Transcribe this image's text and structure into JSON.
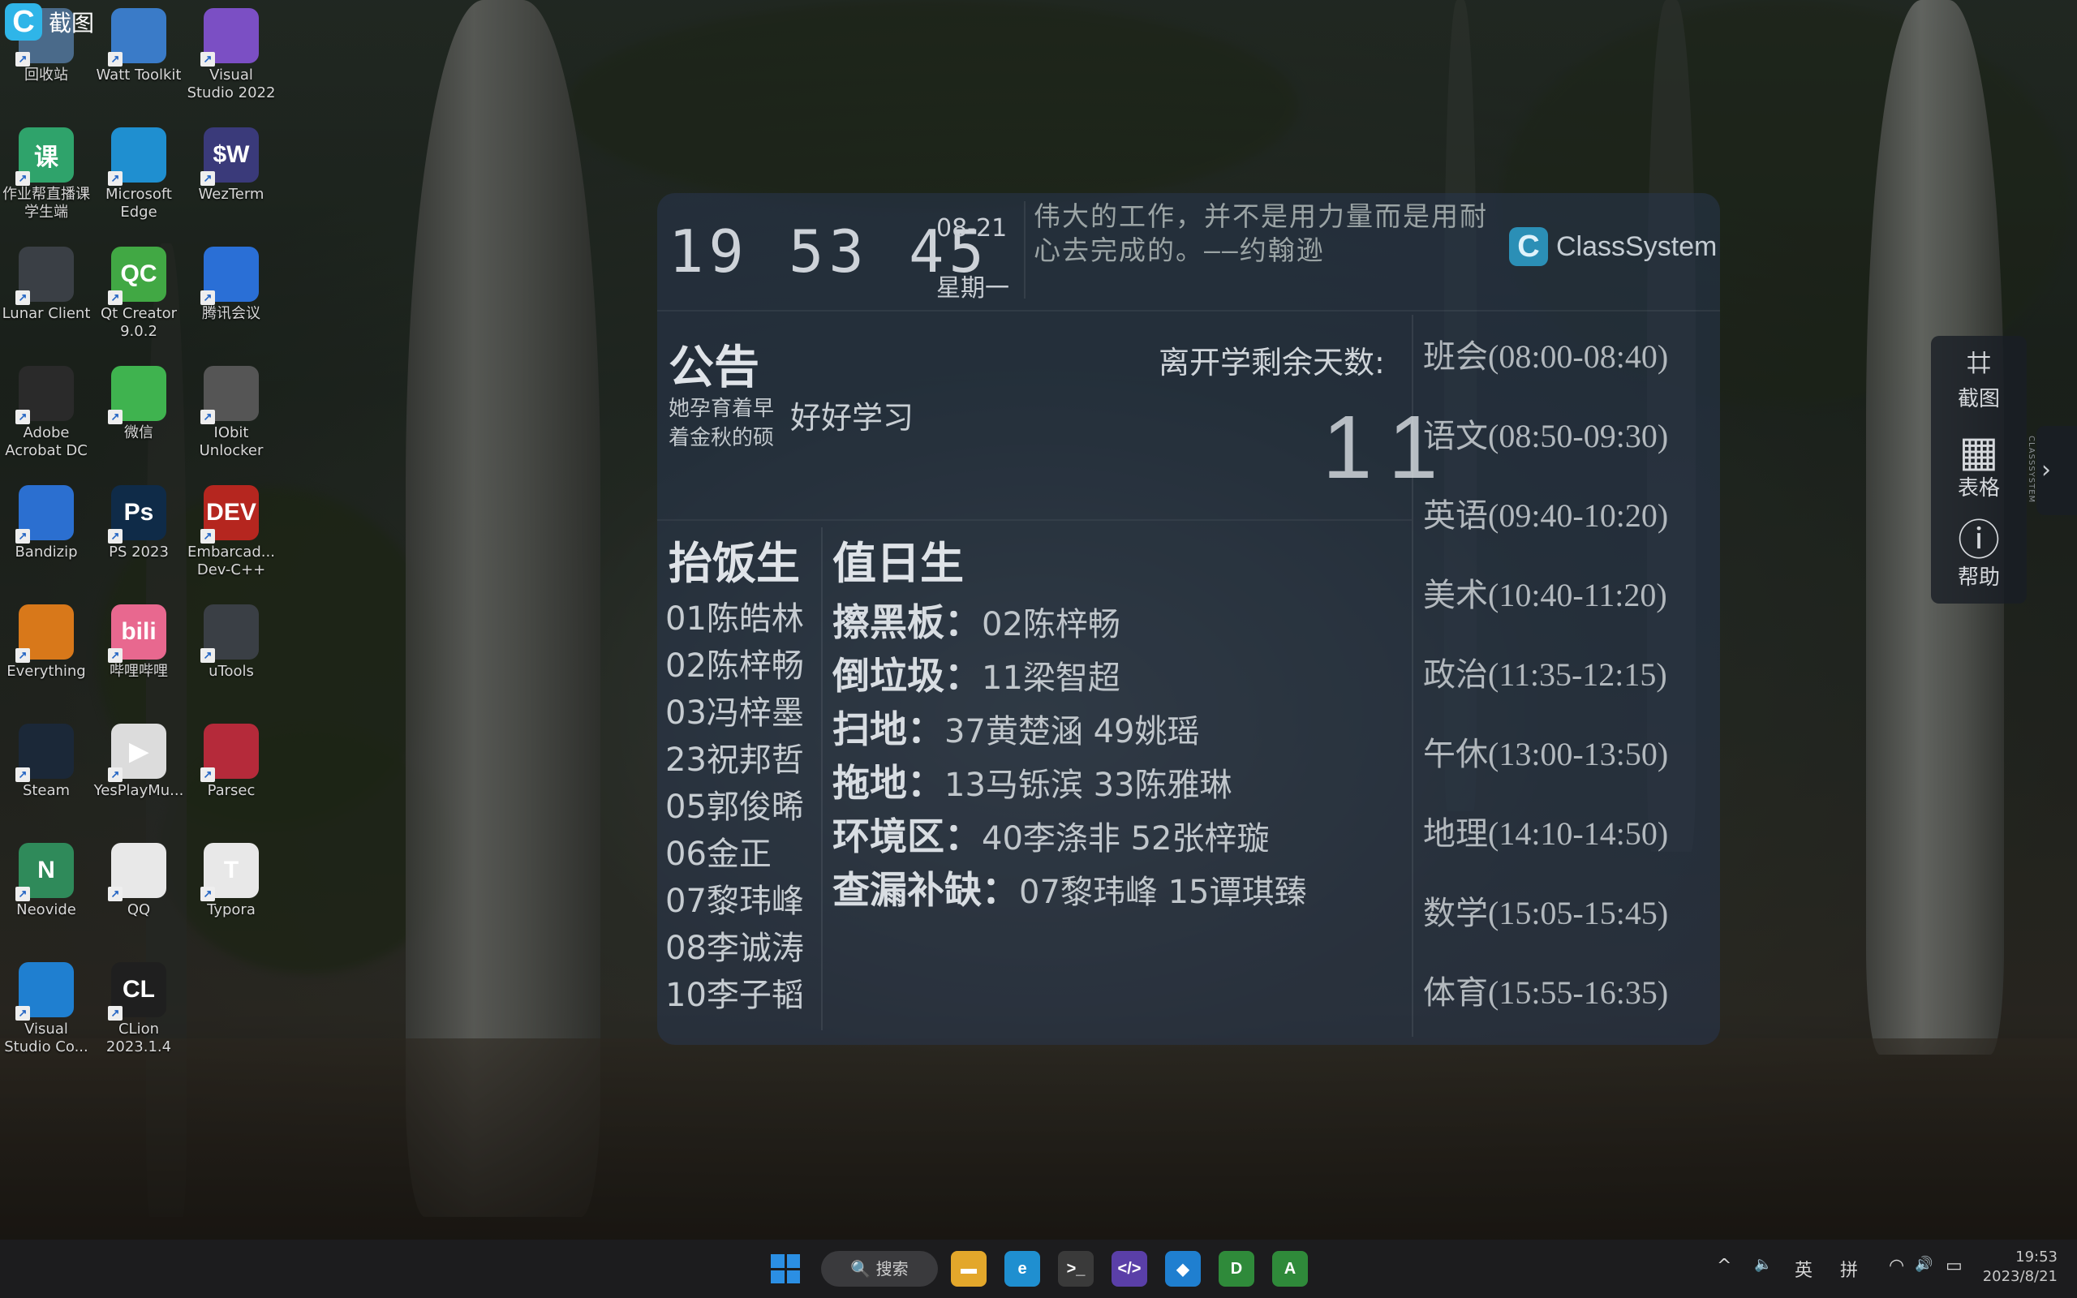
{
  "screenshot_tool": {
    "logo": "C",
    "label": "截图"
  },
  "desktop_icons": [
    {
      "label": "回收站",
      "icon": "recycle-bin-icon",
      "glyph": "",
      "color": "#4a6a8a"
    },
    {
      "label": "Watt Toolkit",
      "icon": "watt-toolkit-icon",
      "glyph": "",
      "color": "#3a7bc8"
    },
    {
      "label": "Visual Studio 2022",
      "icon": "visual-studio-icon",
      "glyph": "",
      "color": "#7b4fc4"
    },
    {
      "label": "作业帮直播课学生端",
      "icon": "zuoyebang-icon",
      "glyph": "课",
      "color": "#2fa36b"
    },
    {
      "label": "Microsoft Edge",
      "icon": "edge-icon",
      "glyph": "",
      "color": "#1f8fd0"
    },
    {
      "label": "WezTerm",
      "icon": "wezterm-icon",
      "glyph": "$W",
      "color": "#3a3a7a"
    },
    {
      "label": "Lunar Client",
      "icon": "lunar-client-icon",
      "glyph": "",
      "color": "#3a3f45"
    },
    {
      "label": "Qt Creator 9.0.2",
      "icon": "qt-creator-icon",
      "glyph": "QC",
      "color": "#41a844"
    },
    {
      "label": "腾讯会议",
      "icon": "tencent-meeting-icon",
      "glyph": "",
      "color": "#2a6fd6"
    },
    {
      "label": "Adobe Acrobat DC",
      "icon": "acrobat-icon",
      "glyph": "",
      "color": "#2a2a2a"
    },
    {
      "label": "微信",
      "icon": "wechat-icon",
      "glyph": "",
      "color": "#3fb34f"
    },
    {
      "label": "IObit Unlocker",
      "icon": "iobit-unlocker-icon",
      "glyph": "",
      "color": "#555"
    },
    {
      "label": "Bandizip",
      "icon": "bandizip-icon",
      "glyph": "",
      "color": "#2b6fd0"
    },
    {
      "label": "PS 2023",
      "icon": "photoshop-icon",
      "glyph": "Ps",
      "color": "#0f2b48"
    },
    {
      "label": "Embarcad... Dev-C++",
      "icon": "devcpp-icon",
      "glyph": "DEV",
      "color": "#b5261f"
    },
    {
      "label": "Everything",
      "icon": "everything-icon",
      "glyph": "",
      "color": "#d8781a"
    },
    {
      "label": "哔哩哔哩",
      "icon": "bilibili-icon",
      "glyph": "bili",
      "color": "#e8688f"
    },
    {
      "label": "uTools",
      "icon": "utools-icon",
      "glyph": "",
      "color": "#3a3f45"
    },
    {
      "label": "Steam",
      "icon": "steam-icon",
      "glyph": "",
      "color": "#1b2838"
    },
    {
      "label": "YesPlayMu...",
      "icon": "yesplaymusic-icon",
      "glyph": "▶",
      "color": "#dcdcdc"
    },
    {
      "label": "Parsec",
      "icon": "parsec-icon",
      "glyph": "",
      "color": "#b52a3a"
    },
    {
      "label": "Neovide",
      "icon": "neovide-icon",
      "glyph": "N",
      "color": "#2f8a5a"
    },
    {
      "label": "QQ",
      "icon": "qq-icon",
      "glyph": "",
      "color": "#e8e8e8"
    },
    {
      "label": "Typora",
      "icon": "typora-icon",
      "glyph": "T",
      "color": "#e8e8e8"
    },
    {
      "label": "Visual Studio Co...",
      "icon": "vscode-icon",
      "glyph": "",
      "color": "#1f7fd0"
    },
    {
      "label": "CLion 2023.1.4",
      "icon": "clion-icon",
      "glyph": "CL",
      "color": "#1f1f1f"
    }
  ],
  "panel": {
    "clock": "19 53 45",
    "date": "08-21",
    "weekday": "星期一",
    "quote": "伟大的工作，并不是用力量而是用耐心去完成的。——约翰逊",
    "brand": "ClassSystem",
    "brand_logo": "C",
    "notice_title": "公告",
    "notice_small": "她孕育着早着金秋的硕",
    "notice_big": "好好学习",
    "days_label": "离开学剩余天数:",
    "days_value": "11",
    "schedule": [
      "班会(08:00-08:40)",
      "语文(08:50-09:30)",
      "英语(09:40-10:20)",
      "美术(10:40-11:20)",
      "政治(11:35-12:15)",
      "午休(13:00-13:50)",
      "地理(14:10-14:50)",
      "数学(15:05-15:45)",
      "体育(15:55-16:35)"
    ],
    "meal_title": "抬饭生",
    "meal_list": [
      "01陈皓林",
      "02陈梓畅",
      "03冯梓墨",
      "23祝邦哲",
      "05郭俊晞",
      "06金正",
      "07黎玮峰",
      "08李诚涛",
      "10李子韬"
    ],
    "duty_title": "值日生",
    "duty": [
      {
        "role": "擦黑板：",
        "names": "02陈梓畅"
      },
      {
        "role": "倒垃圾：",
        "names": "11梁智超"
      },
      {
        "role": "扫地：",
        "names": "37黄楚涵  49姚瑶"
      },
      {
        "role": "拖地：",
        "names": "13马铄滨  33陈雅琳"
      },
      {
        "role": "环境区：",
        "names": "40李涤非  52张梓璇"
      },
      {
        "role": "查漏补缺：",
        "names": "07黎玮峰  15谭琪臻"
      }
    ]
  },
  "toolbar": {
    "items": [
      {
        "label": "截图",
        "icon": "crop-icon",
        "glyph": "⌗"
      },
      {
        "label": "表格",
        "icon": "table-icon",
        "glyph": "▦"
      },
      {
        "label": "帮助",
        "icon": "info-icon",
        "glyph": "ⓘ"
      }
    ],
    "side_tab_arrow": "›",
    "side_tab_text": "CLASSSYSTEM"
  },
  "taskbar": {
    "search_label": "🔍 搜索",
    "apps": [
      {
        "name": "file-explorer",
        "glyph": "▬",
        "color": "#e3a72b"
      },
      {
        "name": "edge",
        "glyph": "e",
        "color": "#1f8fd0"
      },
      {
        "name": "terminal",
        "glyph": ">_",
        "color": "#3a3a3a"
      },
      {
        "name": "devtoys",
        "glyph": "</>",
        "color": "#5a3fa8"
      },
      {
        "name": "vscode",
        "glyph": "◆",
        "color": "#1f7fd0"
      },
      {
        "name": "app-d",
        "glyph": "D",
        "color": "#2f8a3a"
      },
      {
        "name": "app-a",
        "glyph": "A",
        "color": "#2f8a3a"
      }
    ],
    "tray_chevron": "^",
    "tray_volume_left": "🔈",
    "lang1": "英",
    "lang2": "拼",
    "tray_wifi": "◠",
    "tray_volume": "🔊",
    "tray_battery": "▭",
    "time": "19:53",
    "date": "2023/8/21"
  }
}
